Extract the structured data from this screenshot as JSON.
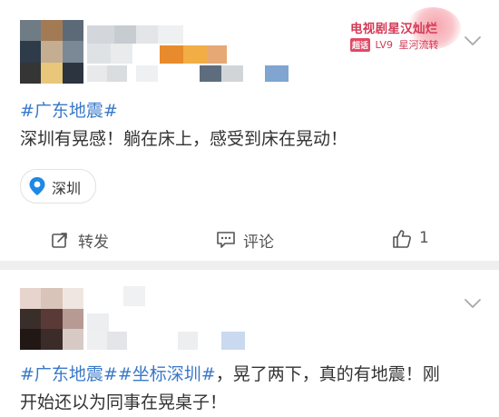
{
  "post1": {
    "badge": {
      "title": "电视剧星汉灿烂",
      "tag": "超话",
      "level": "LV9",
      "name": "星河流转"
    },
    "hashtag": "#广东地震#",
    "text": "深圳有晃感！躺在床上，感受到床在晃动！",
    "location": "深圳",
    "actions": {
      "repost": "转发",
      "comment": "评论",
      "like_count": "1"
    }
  },
  "post2": {
    "hashtag1": "#广东地震#",
    "hashtag2": "#坐标深圳#",
    "text_line1_after": "，晃了两下，真的有地震！刚",
    "text_line2": "开始还以为同事在晃桌子！"
  },
  "colors": {
    "hashtag": "#3a78c9",
    "text": "#333333",
    "badge": "#d33a57",
    "location_pin": "#1e88e5"
  },
  "icons": {
    "chevron": "chevron-down-icon",
    "pin": "location-pin-icon",
    "repost": "repost-icon",
    "comment": "comment-icon",
    "like": "thumbs-up-icon"
  }
}
